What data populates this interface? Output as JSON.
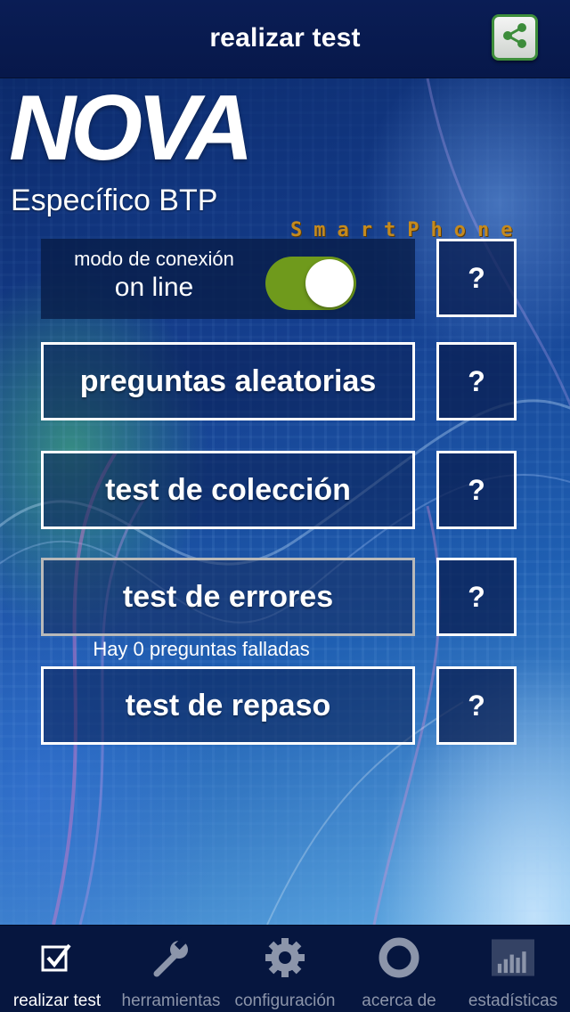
{
  "header": {
    "title": "realizar test",
    "share_icon": "share-icon"
  },
  "logo": {
    "brand": "NOVA",
    "tagline": "SmartPhone"
  },
  "subject": "Específico BTP",
  "connection": {
    "label": "modo de conexión",
    "value": "on line",
    "toggle_on": true,
    "toggle_color": "#6f9a1c"
  },
  "actions": [
    {
      "label": "preguntas aleatorias",
      "help": "?",
      "enabled": true
    },
    {
      "label": "test de colección",
      "help": "?",
      "enabled": true
    },
    {
      "label": "test de errores",
      "help": "?",
      "enabled": false
    },
    {
      "label": "test de repaso",
      "help": "?",
      "enabled": true
    }
  ],
  "connection_help": "?",
  "failed_note": "Hay 0 preguntas falladas",
  "tabbar": {
    "items": [
      {
        "label": "realizar test",
        "icon": "checkbox-icon",
        "active": true
      },
      {
        "label": "herramientas",
        "icon": "wrench-icon",
        "active": false
      },
      {
        "label": "configuración",
        "icon": "gear-icon",
        "active": false
      },
      {
        "label": "acerca de",
        "icon": "lifebuoy-icon",
        "active": false
      },
      {
        "label": "estadísticas",
        "icon": "bar-chart-icon",
        "active": false
      }
    ]
  },
  "colors": {
    "nav_bg": "#0a1d55",
    "tab_bg": "#06163f",
    "share_border": "#3e8e3b",
    "tagline": "#c58a1e"
  }
}
